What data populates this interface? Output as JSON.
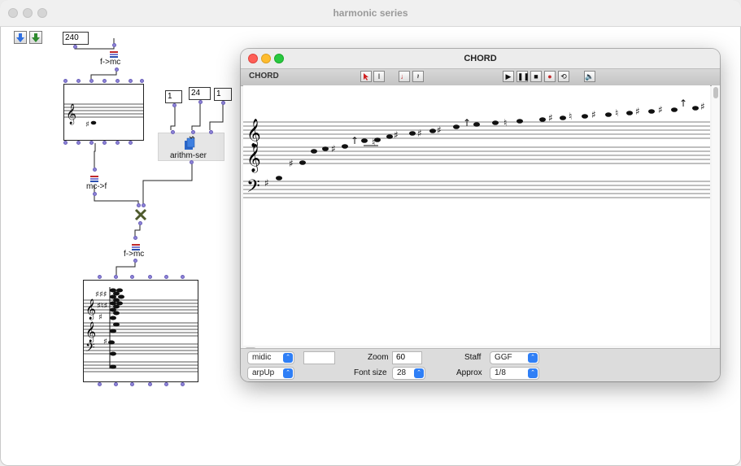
{
  "main_window": {
    "title": "harmonic series"
  },
  "patch": {
    "number_boxes": {
      "fundamental": "240",
      "arith_start": "1",
      "arith_end": "24",
      "arith_step": "1"
    },
    "labels": {
      "f_to_mc_top": "f->mc",
      "mc_to_f": "mc->f",
      "f_to_mc_bottom": "f->mc",
      "arithm_ser": "arithm-ser"
    }
  },
  "chord_window": {
    "title": "CHORD",
    "toolbar": {
      "label": "CHORD"
    },
    "panel": {
      "mode_select": "midic",
      "mode_field": "",
      "zoom_label": "Zoom",
      "zoom_value": "60",
      "staff_label": "Staff",
      "staff_value": "GGF",
      "arp_select": "arpUp",
      "fontsize_label": "Font size",
      "fontsize_value": "28",
      "approx_label": "Approx",
      "approx_value": "1/8"
    }
  },
  "icons": [
    "arrow-down-blue-icon",
    "arrow-down-green-icon",
    "omega-function-icon",
    "cross-multiply-icon",
    "arrow-tool-icon",
    "text-tool-icon",
    "note-icon",
    "rest-icon",
    "play-icon",
    "pause-icon",
    "stop-icon",
    "record-icon",
    "loop-icon",
    "speaker-icon"
  ],
  "colors": {
    "inlet": "#8e83d8",
    "accent": "#2f7ff6",
    "record": "#c0292b"
  }
}
